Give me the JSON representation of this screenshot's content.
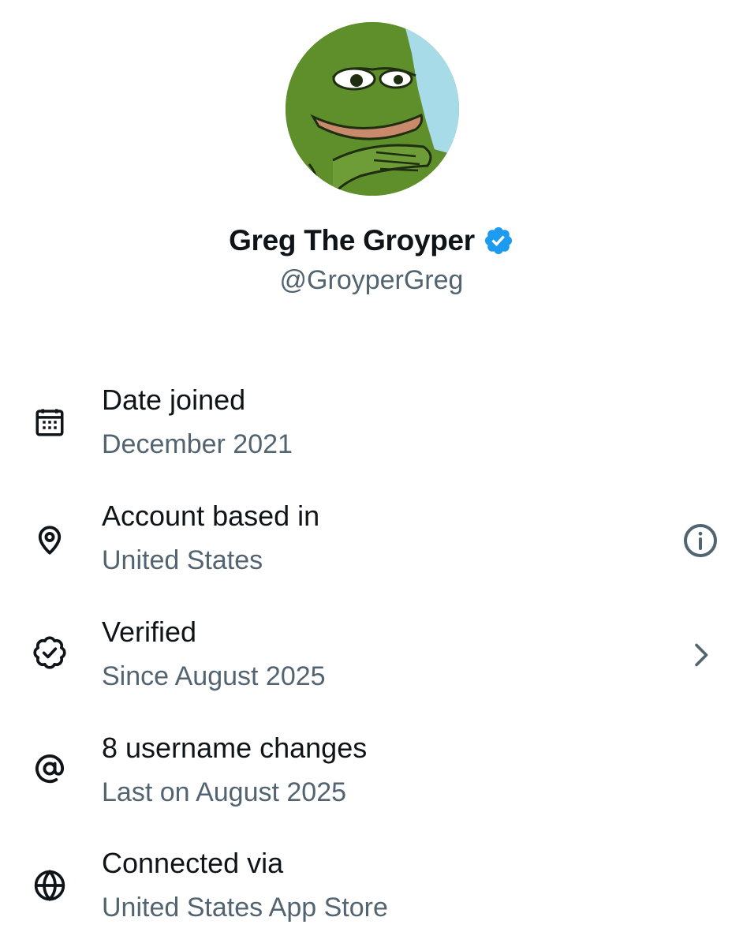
{
  "profile": {
    "display_name": "Greg The Groyper",
    "handle": "@GroyperGreg",
    "verified_color": "#1d9bf0"
  },
  "rows": [
    {
      "icon": "calendar-icon",
      "title": "Date joined",
      "subtitle": "December 2021"
    },
    {
      "icon": "location-pin-icon",
      "title": "Account based in",
      "subtitle": "United States",
      "trailing": "info-icon"
    },
    {
      "icon": "verified-badge-icon",
      "title": "Verified",
      "subtitle": "Since August 2025",
      "trailing": "chevron-right-icon"
    },
    {
      "icon": "at-sign-icon",
      "title": "8 username changes",
      "subtitle": "Last on August 2025"
    },
    {
      "icon": "globe-icon",
      "title": "Connected via",
      "subtitle": "United States App Store"
    }
  ],
  "colors": {
    "text_primary": "#0f1419",
    "text_secondary": "#536471",
    "accent": "#1d9bf0"
  }
}
